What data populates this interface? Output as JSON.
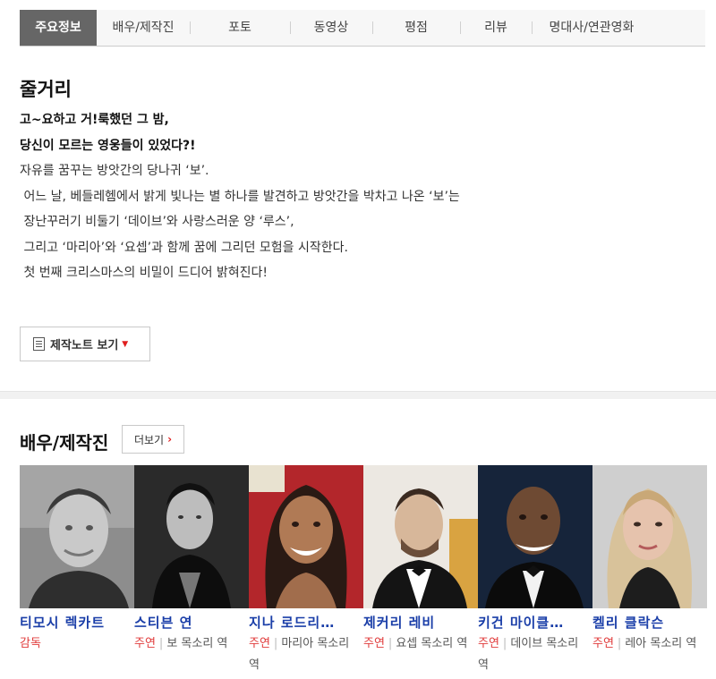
{
  "tabs": [
    "주요정보",
    "배우/제작진",
    "포토",
    "동영상",
    "평점",
    "리뷰",
    "명대사/연관영화"
  ],
  "synopsis": {
    "title": "줄거리",
    "headline": [
      "고~요하고 거!룩했던 그 밤,",
      "당신이 모르는 영웅들이 있었다?!"
    ],
    "lines": [
      "자유를 꿈꾸는 방앗간의 당나귀 ‘보’.",
      " 어느 날, 베들레헴에서 밝게 빛나는 별 하나를 발견하고 방앗간을 박차고 나온 ‘보’는",
      " 장난꾸러기 비둘기 ‘데이브’와 사랑스러운 양 ‘루스’,",
      " 그리고 ‘마리아’와 ‘요셉’과 함께 꿈에 그리던 모험을 시작한다.",
      "",
      " 첫 번째 크리스마스의 비밀이 드디어 밝혀진다!"
    ],
    "note_button": "제작노트 보기"
  },
  "cast_section": {
    "title": "배우/제작진",
    "more_button": "더보기"
  },
  "cast": [
    {
      "name": "티모시 렉카트",
      "role_type": "감독",
      "role": ""
    },
    {
      "name": "스티븐 연",
      "role_type": "주연",
      "role": "보 목소리 역"
    },
    {
      "name": "지나 로드리…",
      "role_type": "주연",
      "role": "마리아 목소리 역"
    },
    {
      "name": "제커리 레비",
      "role_type": "주연",
      "role": "요셉 목소리 역"
    },
    {
      "name": "키건 마이클…",
      "role_type": "주연",
      "role": "데이브 목소리 역"
    },
    {
      "name": "켈리 클락슨",
      "role_type": "주연",
      "role": "레아 목소리 역"
    }
  ],
  "colors": {
    "active_tab": "#666666",
    "link_blue": "#1a3ea8",
    "accent_red": "#e03b3b"
  }
}
